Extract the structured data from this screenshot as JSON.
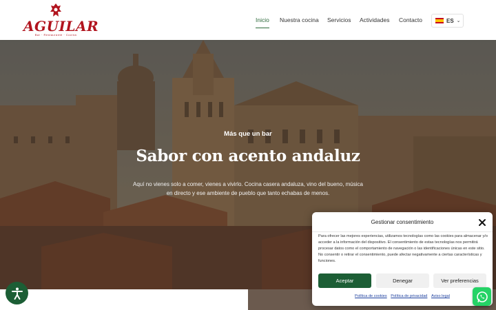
{
  "brand": {
    "name": "AGUILAR",
    "tagline": "Bar · Restaurante · Cocina",
    "color": "#b1141e"
  },
  "nav": {
    "items": [
      {
        "label": "Inicio",
        "active": true
      },
      {
        "label": "Nuestra cocina",
        "active": false
      },
      {
        "label": "Servicios",
        "active": false
      },
      {
        "label": "Actividades",
        "active": false
      },
      {
        "label": "Contacto",
        "active": false
      }
    ],
    "language": {
      "code": "ES",
      "flag_icon": "spain-flag-icon"
    },
    "accent_color": "#2d6a3b"
  },
  "hero": {
    "eyebrow": "Más que un bar",
    "title": "Sabor con acento andaluz",
    "description": "Aquí no vienes solo a comer, vienes a vivirlo. Cocina casera andaluza, vino del bueno, música en directo y ese ambiente de pueblo que tanto echabas de menos."
  },
  "cookie_banner": {
    "title": "Gestionar consentimiento",
    "text": "Para ofrecer las mejores experiencias, utilizamos tecnologías como las cookies para almacenar y/o acceder a la información del dispositivo. El consentimiento de estas tecnologías nos permitirá procesar datos como el comportamiento de navegación o las identificaciones únicas en este sitio. No consentir o retirar el consentimiento, puede afectar negativamente a ciertas características y funciones.",
    "buttons": {
      "accept": "Aceptar",
      "deny": "Denegar",
      "preferences": "Ver preferencias"
    },
    "links": [
      "Política de cookies",
      "Política de privacidad",
      "Aviso legal"
    ],
    "accent_color": "#1c5e35"
  },
  "floating": {
    "accessibility_icon": "accessibility-icon",
    "whatsapp_icon": "whatsapp-icon"
  }
}
